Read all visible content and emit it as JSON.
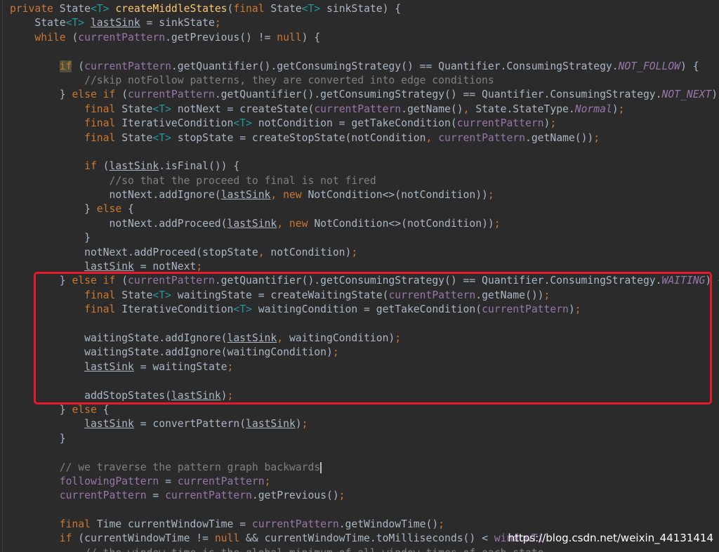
{
  "code_lines": [
    [
      [
        "kw",
        "private "
      ],
      [
        "t",
        "State"
      ],
      [
        "generic",
        "<T>"
      ],
      [
        "t",
        " "
      ],
      [
        "method",
        "createMiddleStates"
      ],
      [
        "t",
        "("
      ],
      [
        "kw",
        "final "
      ],
      [
        "t",
        "State"
      ],
      [
        "generic",
        "<T>"
      ],
      [
        "t",
        " sinkState) {"
      ]
    ],
    [
      [
        "t",
        "    State"
      ],
      [
        "generic",
        "<T>"
      ],
      [
        "t",
        " "
      ],
      [
        "u",
        "lastSink"
      ],
      [
        "t",
        " = sinkState"
      ],
      [
        "kw",
        ";"
      ]
    ],
    [
      [
        "t",
        "    "
      ],
      [
        "kw",
        "while "
      ],
      [
        "t",
        "("
      ],
      [
        "field",
        "currentPattern"
      ],
      [
        "t",
        ".getPrevious() != "
      ],
      [
        "kw",
        "null"
      ],
      [
        "t",
        ") {"
      ]
    ],
    [
      [
        "t",
        ""
      ]
    ],
    [
      [
        "t",
        "        "
      ],
      [
        "kwif",
        "if"
      ],
      [
        "t",
        " ("
      ],
      [
        "field",
        "currentPattern"
      ],
      [
        "t",
        ".getQuantifier().getConsumingStrategy() == Quantifier.ConsumingStrategy."
      ],
      [
        "fieldi",
        "NOT_FOLLOW"
      ],
      [
        "t",
        ") {"
      ]
    ],
    [
      [
        "t",
        "            "
      ],
      [
        "comment",
        "//skip notFollow patterns, they are converted into edge conditions"
      ]
    ],
    [
      [
        "t",
        "        } "
      ],
      [
        "kw",
        "else if "
      ],
      [
        "t",
        "("
      ],
      [
        "field",
        "currentPattern"
      ],
      [
        "t",
        ".getQuantifier().getConsumingStrategy() == Quantifier.ConsumingStrategy."
      ],
      [
        "fieldi",
        "NOT_NEXT"
      ],
      [
        "t",
        ") {"
      ]
    ],
    [
      [
        "t",
        "            "
      ],
      [
        "kw",
        "final "
      ],
      [
        "t",
        "State"
      ],
      [
        "generic",
        "<T>"
      ],
      [
        "t",
        " notNext = createState("
      ],
      [
        "field",
        "currentPattern"
      ],
      [
        "t",
        ".getName()"
      ],
      [
        "kw",
        ", "
      ],
      [
        "t",
        "State.StateType."
      ],
      [
        "fieldi",
        "Normal"
      ],
      [
        "t",
        ")"
      ],
      [
        "kw",
        ";"
      ]
    ],
    [
      [
        "t",
        "            "
      ],
      [
        "kw",
        "final "
      ],
      [
        "t",
        "IterativeCondition"
      ],
      [
        "generic",
        "<T>"
      ],
      [
        "t",
        " notCondition = getTakeCondition("
      ],
      [
        "field",
        "currentPattern"
      ],
      [
        "t",
        ")"
      ],
      [
        "kw",
        ";"
      ]
    ],
    [
      [
        "t",
        "            "
      ],
      [
        "kw",
        "final "
      ],
      [
        "t",
        "State"
      ],
      [
        "generic",
        "<T>"
      ],
      [
        "t",
        " stopState = createStopState(notCondition"
      ],
      [
        "kw",
        ", "
      ],
      [
        "field",
        "currentPattern"
      ],
      [
        "t",
        ".getName())"
      ],
      [
        "kw",
        ";"
      ]
    ],
    [
      [
        "t",
        ""
      ]
    ],
    [
      [
        "t",
        "            "
      ],
      [
        "kw",
        "if "
      ],
      [
        "t",
        "("
      ],
      [
        "u",
        "lastSink"
      ],
      [
        "t",
        ".isFinal()) {"
      ]
    ],
    [
      [
        "t",
        "                "
      ],
      [
        "comment",
        "//so that the proceed to final is not fired"
      ]
    ],
    [
      [
        "t",
        "                notNext.addIgnore("
      ],
      [
        "u",
        "lastSink"
      ],
      [
        "kw",
        ", new "
      ],
      [
        "t",
        "NotCondition<>(notCondition))"
      ],
      [
        "kw",
        ";"
      ]
    ],
    [
      [
        "t",
        "            } "
      ],
      [
        "kw",
        "else "
      ],
      [
        "t",
        "{"
      ]
    ],
    [
      [
        "t",
        "                notNext.addProceed("
      ],
      [
        "u",
        "lastSink"
      ],
      [
        "kw",
        ", new "
      ],
      [
        "t",
        "NotCondition<>(notCondition))"
      ],
      [
        "kw",
        ";"
      ]
    ],
    [
      [
        "t",
        "            }"
      ]
    ],
    [
      [
        "t",
        "            notNext.addProceed(stopState"
      ],
      [
        "kw",
        ", "
      ],
      [
        "t",
        "notCondition)"
      ],
      [
        "kw",
        ";"
      ]
    ],
    [
      [
        "t",
        "            "
      ],
      [
        "u",
        "lastSink"
      ],
      [
        "t",
        " = notNext"
      ],
      [
        "kw",
        ";"
      ]
    ],
    [
      [
        "t",
        "        } "
      ],
      [
        "kw",
        "else if "
      ],
      [
        "t",
        "("
      ],
      [
        "field",
        "currentPattern"
      ],
      [
        "t",
        ".getQuantifier().getConsumingStrategy() == Quantifier.ConsumingStrategy."
      ],
      [
        "fieldi",
        "WAITING"
      ],
      [
        "t",
        ") {"
      ]
    ],
    [
      [
        "t",
        "            "
      ],
      [
        "kw",
        "final "
      ],
      [
        "t",
        "State"
      ],
      [
        "generic",
        "<T>"
      ],
      [
        "t",
        " waitingState = createWaitingState("
      ],
      [
        "field",
        "currentPattern"
      ],
      [
        "t",
        ".getName())"
      ],
      [
        "kw",
        ";"
      ]
    ],
    [
      [
        "t",
        "            "
      ],
      [
        "kw",
        "final "
      ],
      [
        "t",
        "IterativeCondition"
      ],
      [
        "generic",
        "<T>"
      ],
      [
        "t",
        " waitingCondition = getTakeCondition("
      ],
      [
        "field",
        "currentPattern"
      ],
      [
        "t",
        ")"
      ],
      [
        "kw",
        ";"
      ]
    ],
    [
      [
        "t",
        ""
      ]
    ],
    [
      [
        "t",
        "            waitingState.addIgnore("
      ],
      [
        "u",
        "lastSink"
      ],
      [
        "kw",
        ", "
      ],
      [
        "t",
        "waitingCondition)"
      ],
      [
        "kw",
        ";"
      ]
    ],
    [
      [
        "t",
        "            waitingState.addIgnore(waitingCondition)"
      ],
      [
        "kw",
        ";"
      ]
    ],
    [
      [
        "t",
        "            "
      ],
      [
        "u",
        "lastSink"
      ],
      [
        "t",
        " = waitingState"
      ],
      [
        "kw",
        ";"
      ]
    ],
    [
      [
        "t",
        ""
      ]
    ],
    [
      [
        "t",
        "            addStopStates("
      ],
      [
        "u",
        "lastSink"
      ],
      [
        "t",
        ")"
      ],
      [
        "kw",
        ";"
      ]
    ],
    [
      [
        "t",
        "        } "
      ],
      [
        "kw",
        "else "
      ],
      [
        "t",
        "{"
      ]
    ],
    [
      [
        "t",
        "            "
      ],
      [
        "u",
        "lastSink"
      ],
      [
        "t",
        " = convertPattern("
      ],
      [
        "u",
        "lastSink"
      ],
      [
        "t",
        ")"
      ],
      [
        "kw",
        ";"
      ]
    ],
    [
      [
        "t",
        "        }"
      ]
    ],
    [
      [
        "t",
        ""
      ]
    ],
    [
      [
        "t",
        "        "
      ],
      [
        "comment",
        "// we traverse the pattern graph backwards"
      ],
      [
        "caret",
        ""
      ]
    ],
    [
      [
        "t",
        "        "
      ],
      [
        "field",
        "followingPattern"
      ],
      [
        "t",
        " = "
      ],
      [
        "field",
        "currentPattern"
      ],
      [
        "kw",
        ";"
      ]
    ],
    [
      [
        "t",
        "        "
      ],
      [
        "field",
        "currentPattern"
      ],
      [
        "t",
        " = "
      ],
      [
        "field",
        "currentPattern"
      ],
      [
        "t",
        ".getPrevious()"
      ],
      [
        "kw",
        ";"
      ]
    ],
    [
      [
        "t",
        ""
      ]
    ],
    [
      [
        "t",
        "        "
      ],
      [
        "kw",
        "final "
      ],
      [
        "t",
        "Time currentWindowTime = "
      ],
      [
        "field",
        "currentPattern"
      ],
      [
        "t",
        ".getWindowTime()"
      ],
      [
        "kw",
        ";"
      ]
    ],
    [
      [
        "t",
        "        "
      ],
      [
        "kw",
        "if "
      ],
      [
        "t",
        "(currentWindowTime != "
      ],
      [
        "kw",
        "null "
      ],
      [
        "t",
        "&& currentWindowTime.toMilliseconds() < "
      ],
      [
        "field",
        "windowTi"
      ]
    ],
    [
      [
        "t",
        "            "
      ],
      [
        "comment",
        "// the window time is the global minimum of all window times of each state"
      ]
    ]
  ],
  "watermark": "https://blog.csdn.net/weixin_44131414",
  "colors": {
    "background": "#2b2b2b",
    "keyword": "#cc7832",
    "method": "#ffc66d",
    "generic": "#20999d",
    "field": "#9876aa",
    "comment": "#808080",
    "text": "#a9b7c6",
    "highlight_box": "#e8192a"
  }
}
